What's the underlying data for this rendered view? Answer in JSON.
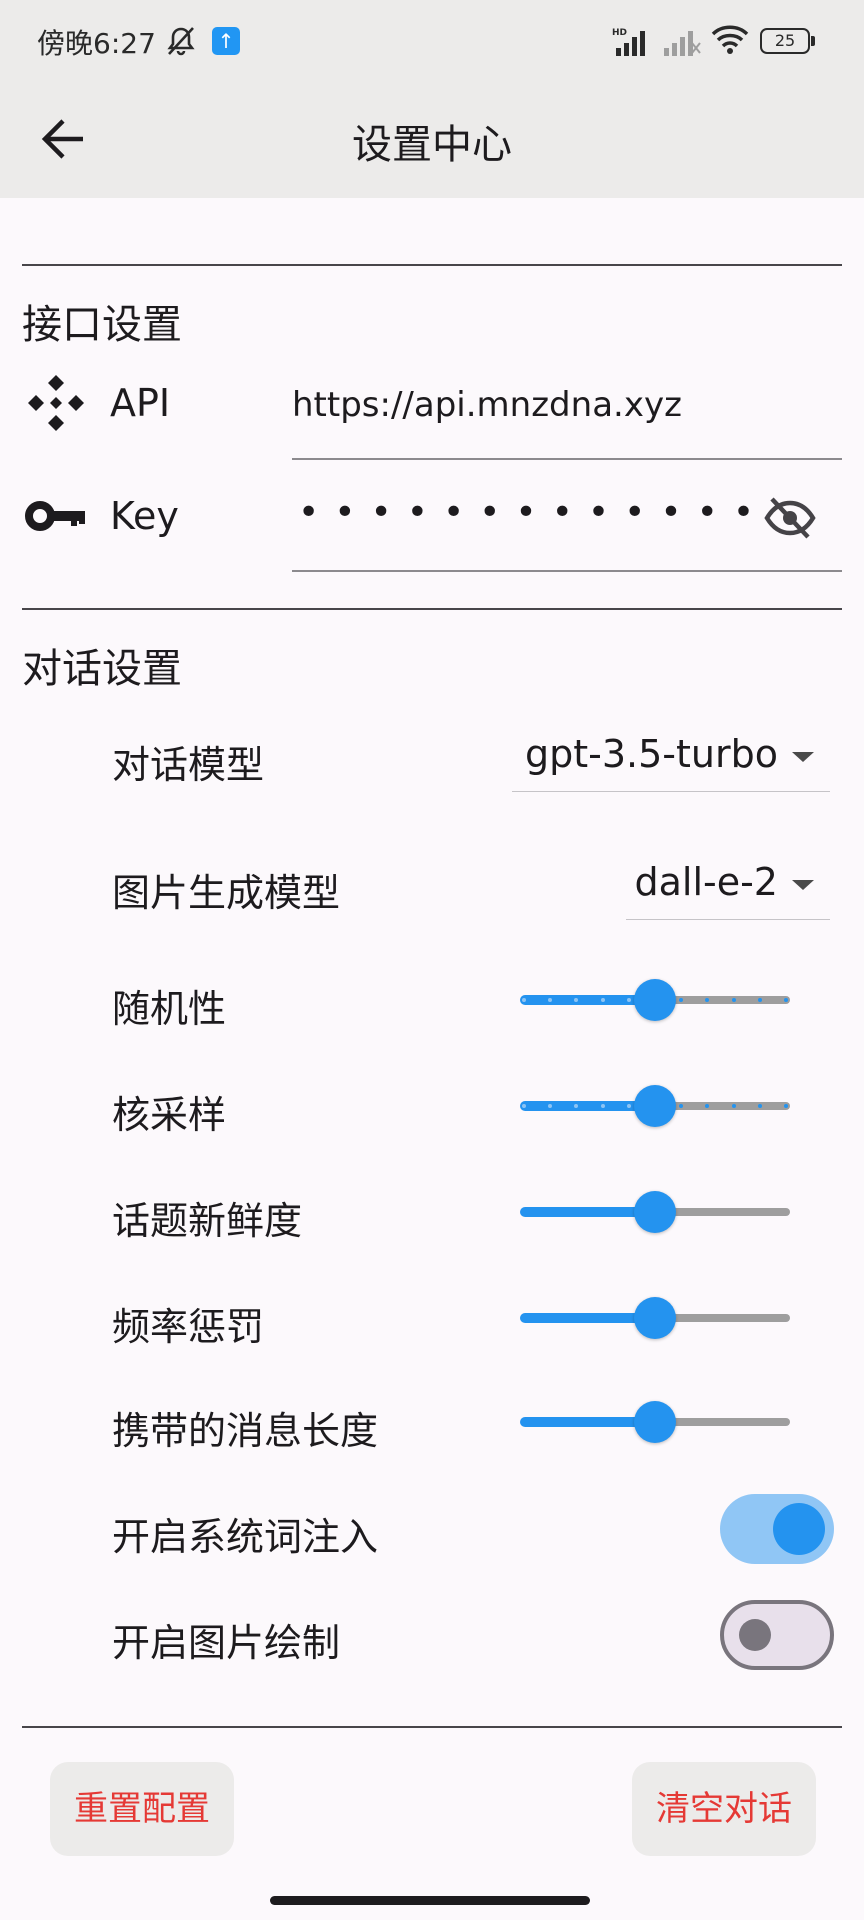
{
  "status_bar": {
    "time": "傍晚6:27",
    "battery": "25",
    "icons": [
      "mute-icon",
      "upload-icon",
      "hd-signal-icon",
      "signal-icon",
      "wifi-icon",
      "battery-icon"
    ]
  },
  "app_bar": {
    "title": "设置中心",
    "back_icon": "arrow-back-icon"
  },
  "api_section": {
    "title": "接口设置",
    "api": {
      "label": "API",
      "icon": "api-icon",
      "value": "https://api.mnzdna.xyz"
    },
    "key": {
      "label": "Key",
      "icon": "key-icon",
      "masked_value": "•••••••••••••",
      "toggle_icon": "visibility-off-icon"
    }
  },
  "chat_section": {
    "title": "对话设置",
    "chat_model": {
      "label": "对话模型",
      "value": "gpt-3.5-turbo"
    },
    "image_model": {
      "label": "图片生成模型",
      "value": "dall-e-2"
    },
    "sliders": [
      {
        "label": "随机性",
        "value": 0.5,
        "discrete": true
      },
      {
        "label": "核采样",
        "value": 0.5,
        "discrete": true
      },
      {
        "label": "话题新鲜度",
        "value": 0.5,
        "discrete": false
      },
      {
        "label": "频率惩罚",
        "value": 0.5,
        "discrete": false
      },
      {
        "label": "携带的消息长度",
        "value": 0.5,
        "discrete": false
      }
    ],
    "toggles": [
      {
        "label": "开启系统词注入",
        "on": true
      },
      {
        "label": "开启图片绘制",
        "on": false
      }
    ]
  },
  "actions": {
    "reset": "重置配置",
    "clear": "清空对话"
  },
  "colors": {
    "accent": "#2493ef",
    "danger": "#e53935",
    "bar_background": "#ecebea"
  }
}
